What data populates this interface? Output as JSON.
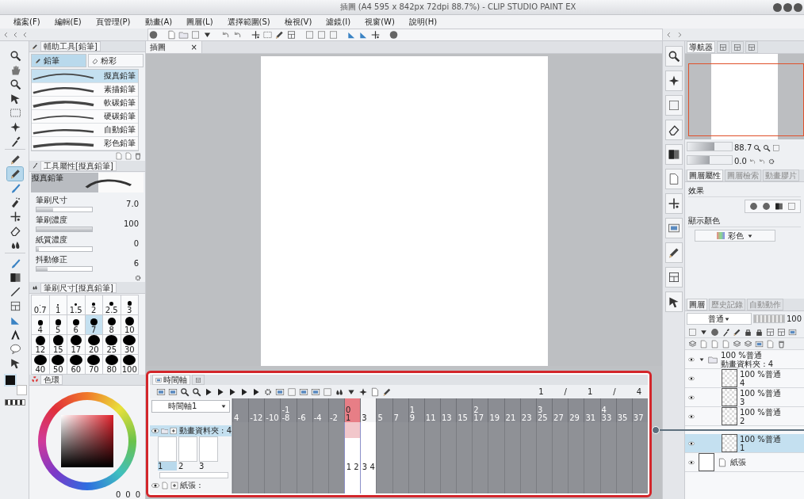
{
  "window": {
    "title": "插圖 (A4 595 x 842px 72dpi 88.7%) - CLIP STUDIO PAINT EX"
  },
  "menu": [
    "檔案(F)",
    "編輯(E)",
    "頁管理(P)",
    "動畫(A)",
    "圖層(L)",
    "選擇範圍(S)",
    "檢視(V)",
    "濾鏡(I)",
    "視窗(W)",
    "說明(H)"
  ],
  "tools": [
    {
      "selected": false
    },
    {
      "selected": false
    },
    {
      "selected": false
    },
    {
      "selected": false
    },
    {
      "selected": false
    },
    {
      "selected": false
    },
    {
      "selected": false
    },
    {
      "selected": false
    },
    {
      "selected": true
    },
    {
      "selected": false
    },
    {
      "selected": false
    },
    {
      "selected": false
    },
    {
      "selected": false
    },
    {
      "selected": false
    },
    {
      "selected": false
    },
    {
      "selected": false
    },
    {
      "selected": false
    },
    {
      "selected": false
    },
    {
      "selected": false
    },
    {
      "selected": false
    },
    {
      "selected": false
    },
    {
      "selected": false
    }
  ],
  "sub_tool": {
    "title": "輔助工具[鉛筆]",
    "tabs": [
      {
        "label": "鉛筆",
        "selected": true
      },
      {
        "label": "粉彩",
        "selected": false
      }
    ],
    "brushes": [
      {
        "name": "擬真鉛筆",
        "selected": true
      },
      {
        "name": "素描鉛筆",
        "selected": false
      },
      {
        "name": "軟碳鉛筆",
        "selected": false
      },
      {
        "name": "硬碳鉛筆",
        "selected": false
      },
      {
        "name": "自動鉛筆",
        "selected": false
      },
      {
        "name": "彩色鉛筆",
        "selected": false
      }
    ]
  },
  "tool_property": {
    "title": "工具屬性[擬真鉛筆]",
    "preview_label": "擬真鉛筆",
    "settings": [
      {
        "label": "筆刷尺寸",
        "value": "7.0",
        "level": 0.3
      },
      {
        "label": "筆刷濃度",
        "value": "100",
        "level": 1
      },
      {
        "label": "紙質濃度",
        "value": "0",
        "level": 0.04
      },
      {
        "label": "抖動修正",
        "value": "6",
        "level": 0.2
      }
    ]
  },
  "brush_size": {
    "title": "筆刷尺寸[擬真鉛筆]",
    "sizes": [
      {
        "label": "0.7",
        "selected": false
      },
      {
        "label": "1",
        "selected": false
      },
      {
        "label": "1.5",
        "selected": false
      },
      {
        "label": "2",
        "selected": false
      },
      {
        "label": "2.5",
        "selected": false
      },
      {
        "label": "3",
        "selected": false
      },
      {
        "label": "4",
        "selected": false
      },
      {
        "label": "5",
        "selected": false
      },
      {
        "label": "6",
        "selected": false
      },
      {
        "label": "7",
        "selected": true
      },
      {
        "label": "8",
        "selected": false
      },
      {
        "label": "10",
        "selected": false
      },
      {
        "label": "12",
        "selected": false
      },
      {
        "label": "15",
        "selected": false
      },
      {
        "label": "17",
        "selected": false
      },
      {
        "label": "20",
        "selected": false
      },
      {
        "label": "25",
        "selected": false
      },
      {
        "label": "30",
        "selected": false
      },
      {
        "label": "40",
        "selected": false
      },
      {
        "label": "50",
        "selected": false
      },
      {
        "label": "60",
        "selected": false
      },
      {
        "label": "70",
        "selected": false
      },
      {
        "label": "80",
        "selected": false
      },
      {
        "label": "100",
        "selected": false
      }
    ]
  },
  "color_panel": {
    "tab": "色環",
    "values": [
      "0",
      "0",
      "0"
    ]
  },
  "canvas": {
    "tab": "插圖",
    "close": "×"
  },
  "timeline": {
    "tabs": [
      {
        "label": "時間軸",
        "selected": true
      },
      {
        "selected": false
      }
    ],
    "counter": [
      "1",
      "/",
      "1",
      "/",
      "4"
    ],
    "track_select": "時間軸1",
    "frames": [
      {
        "label": "4"
      },
      {
        "label": "-12"
      },
      {
        "label": "-10"
      },
      {
        "label": "-8",
        "second": "-1"
      },
      {
        "label": "-6"
      },
      {
        "label": "-4"
      },
      {
        "label": "-2"
      },
      {
        "label": "1",
        "second": "0",
        "range": true,
        "current": true
      },
      {
        "label": "3",
        "range": true
      },
      {
        "label": "5"
      },
      {
        "label": "7"
      },
      {
        "label": "9",
        "second": "1"
      },
      {
        "label": "11"
      },
      {
        "label": "13"
      },
      {
        "label": "15"
      },
      {
        "label": "17",
        "second": "2"
      },
      {
        "label": "19"
      },
      {
        "label": "21"
      },
      {
        "label": "23"
      },
      {
        "label": "25",
        "second": "3"
      },
      {
        "label": "27"
      },
      {
        "label": "29"
      },
      {
        "label": "31"
      },
      {
        "label": "33",
        "second": "4"
      },
      {
        "label": "35"
      },
      {
        "label": "37"
      }
    ],
    "frame_cells": [
      "1",
      "2",
      "3",
      "4"
    ],
    "tracks": [
      {
        "kind": "folder",
        "name": "動畫資料夾 : 4",
        "selected": true,
        "cels": [
          {
            "label": "1",
            "selected": true
          },
          {
            "label": "2",
            "selected": false
          },
          {
            "label": "3",
            "selected": false
          }
        ]
      },
      {
        "kind": "paper",
        "name": "紙張 :",
        "selected": false
      }
    ]
  },
  "navigator": {
    "tabs": [
      {
        "label": "導航器",
        "selected": true
      },
      {
        "selected": false
      },
      {
        "selected": false
      },
      {
        "selected": false
      }
    ],
    "zoom": {
      "value": "88.7",
      "level": 0.6
    },
    "angle": {
      "value": "0.0",
      "level": 0.5
    }
  },
  "layer_property": {
    "tabs": [
      {
        "label": "圖層屬性",
        "selected": true
      },
      {
        "label": "圖層檢索",
        "selected": false
      },
      {
        "label": "動畫膠片",
        "selected": false
      }
    ],
    "effect_label": "效果",
    "display_color_label": "顯示顏色",
    "display_color": "彩色"
  },
  "layers": {
    "tabs": [
      {
        "label": "圖層",
        "selected": true
      },
      {
        "label": "歷史記錄",
        "selected": false
      },
      {
        "label": "自動動作",
        "selected": false
      }
    ],
    "blend_mode": "普通",
    "opacity": {
      "value": "100",
      "level": 1
    },
    "items": [
      {
        "kind": "folder",
        "mode": "100 %普通",
        "name": "動畫資料夾 : 4",
        "selected": false,
        "expanded": true,
        "children": [
          {
            "kind": "raster",
            "mode": "100 %普通",
            "name": "4",
            "selected": false
          },
          {
            "kind": "raster",
            "mode": "100 %普通",
            "name": "3",
            "selected": false
          },
          {
            "kind": "raster",
            "mode": "100 %普通",
            "name": "2",
            "selected": false
          },
          {
            "kind": "raster",
            "mode": "100 %普通",
            "name": "1",
            "selected": true
          }
        ]
      },
      {
        "kind": "paper",
        "name": "紙張",
        "selected": false
      }
    ]
  }
}
